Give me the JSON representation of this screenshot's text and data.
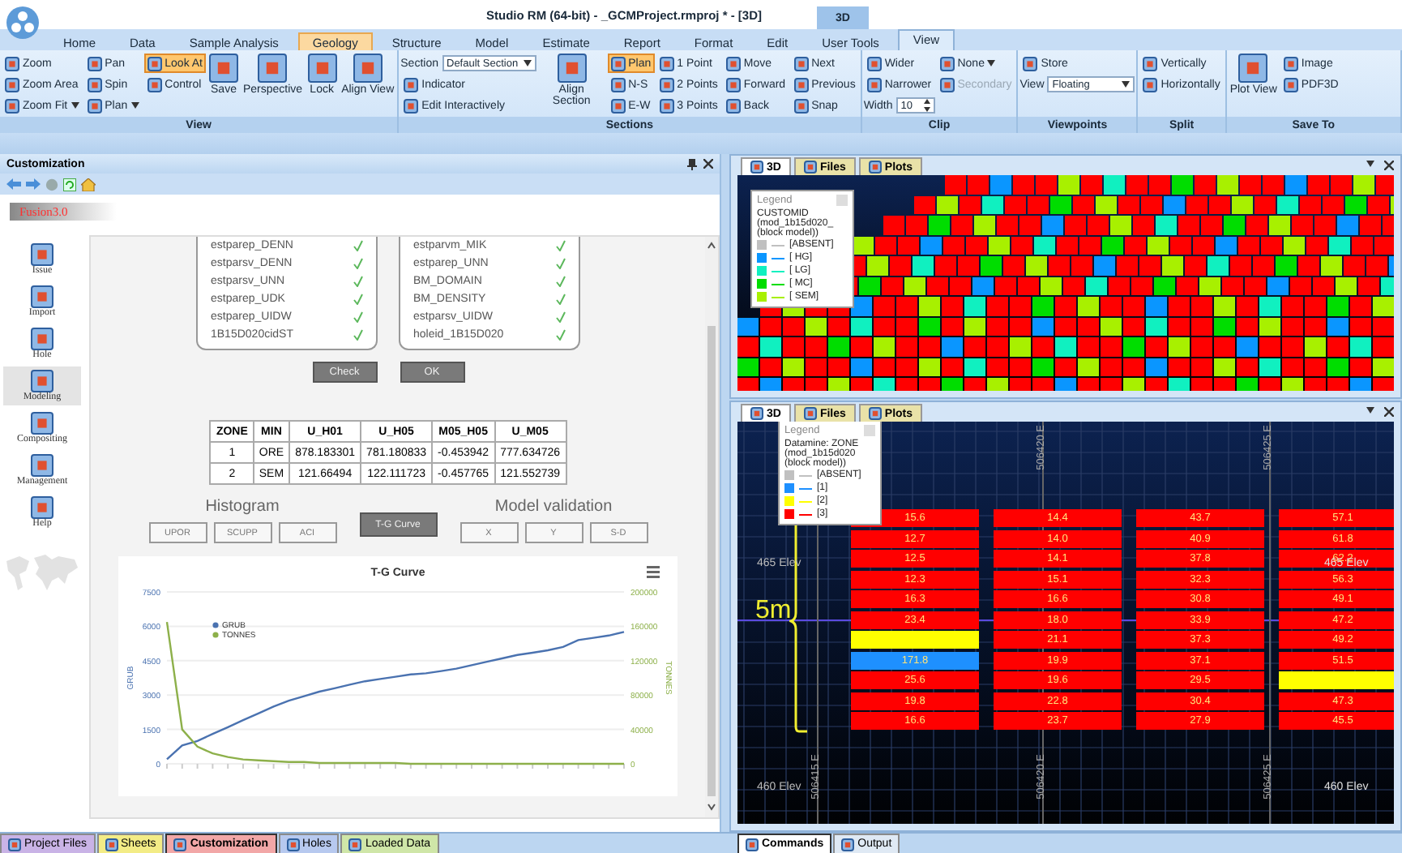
{
  "window": {
    "title": "Studio RM (64-bit) - _GCMProject.rmproj * - [3D]",
    "context_tab": "3D"
  },
  "ribbon_tabs": [
    {
      "label": "Home",
      "selected": false,
      "highlighted": false
    },
    {
      "label": "Data",
      "selected": false,
      "highlighted": false
    },
    {
      "label": "Sample Analysis",
      "selected": false,
      "highlighted": false
    },
    {
      "label": "Geology",
      "selected": false,
      "highlighted": true
    },
    {
      "label": "Structure",
      "selected": false,
      "highlighted": false
    },
    {
      "label": "Model",
      "selected": false,
      "highlighted": false
    },
    {
      "label": "Estimate",
      "selected": false,
      "highlighted": false
    },
    {
      "label": "Report",
      "selected": false,
      "highlighted": false
    },
    {
      "label": "Format",
      "selected": false,
      "highlighted": false
    },
    {
      "label": "Edit",
      "selected": false,
      "highlighted": false
    },
    {
      "label": "User Tools",
      "selected": false,
      "highlighted": false
    },
    {
      "label": "View",
      "selected": true,
      "highlighted": false
    }
  ],
  "ribbon_groups": [
    {
      "label": "View",
      "columns": [
        [
          {
            "label": "Zoom",
            "kind": "small"
          },
          {
            "label": "Zoom Area",
            "kind": "small"
          },
          {
            "label": "Zoom Fit",
            "kind": "menu"
          }
        ],
        [
          {
            "label": "Pan",
            "kind": "small"
          },
          {
            "label": "Spin",
            "kind": "small"
          },
          {
            "label": "Plan",
            "kind": "menu"
          }
        ],
        [
          {
            "label": "Look At",
            "kind": "pressed"
          },
          {
            "label": "Control",
            "kind": "small"
          }
        ],
        [
          {
            "label": "Save",
            "kind": "large"
          }
        ],
        [
          {
            "label": "Perspective",
            "kind": "large"
          }
        ],
        [
          {
            "label": "Lock",
            "kind": "large"
          }
        ],
        [
          {
            "label": "Align View",
            "kind": "large"
          }
        ]
      ]
    },
    {
      "label": "Sections",
      "columns": [
        [
          {
            "label": "Section",
            "kind": "select",
            "value": "Default Section"
          },
          {
            "label": "Indicator",
            "kind": "small"
          },
          {
            "label": "Edit Interactively",
            "kind": "small"
          }
        ],
        [
          {
            "label": "Align Section",
            "kind": "large"
          }
        ],
        [
          {
            "label": "Plan",
            "kind": "pressed"
          },
          {
            "label": "N-S",
            "kind": "small"
          },
          {
            "label": "E-W",
            "kind": "small"
          }
        ],
        [
          {
            "label": "1 Point",
            "kind": "small"
          },
          {
            "label": "2 Points",
            "kind": "small"
          },
          {
            "label": "3 Points",
            "kind": "small"
          }
        ],
        [
          {
            "label": "Move",
            "kind": "small"
          },
          {
            "label": "Forward",
            "kind": "small"
          },
          {
            "label": "Back",
            "kind": "small"
          }
        ],
        [
          {
            "label": "Next",
            "kind": "small"
          },
          {
            "label": "Previous",
            "kind": "small"
          },
          {
            "label": "Snap",
            "kind": "small"
          }
        ]
      ]
    },
    {
      "label": "Clip",
      "columns": [
        [
          {
            "label": "Wider",
            "kind": "small"
          },
          {
            "label": "Narrower",
            "kind": "small"
          },
          {
            "label": "Width",
            "kind": "spin",
            "value": "10"
          }
        ],
        [
          {
            "label": "None",
            "kind": "menu"
          },
          {
            "label": "Secondary",
            "kind": "disabled"
          }
        ]
      ]
    },
    {
      "label": "Viewpoints",
      "columns": [
        [
          {
            "label": "Store",
            "kind": "small"
          },
          {
            "label": "View",
            "kind": "select",
            "value": "Floating"
          }
        ]
      ]
    },
    {
      "label": "Split",
      "columns": [
        [
          {
            "label": "Vertically",
            "kind": "small"
          },
          {
            "label": "Horizontally",
            "kind": "small"
          }
        ]
      ]
    },
    {
      "label": "Save To",
      "columns": [
        [
          {
            "label": "Plot View",
            "kind": "large"
          }
        ],
        [
          {
            "label": "Image",
            "kind": "small"
          },
          {
            "label": "PDF3D",
            "kind": "small"
          }
        ]
      ]
    }
  ],
  "panel": {
    "title": "Customization",
    "brand": "Fusion3.0",
    "nav": [
      {
        "label": "Issue",
        "selected": false
      },
      {
        "label": "Import",
        "selected": false
      },
      {
        "label": "Hole",
        "selected": false
      },
      {
        "label": "Modeling",
        "selected": true
      },
      {
        "label": "Compositing",
        "selected": false
      },
      {
        "label": "Management",
        "selected": false
      },
      {
        "label": "Help",
        "selected": false
      }
    ],
    "lists": [
      [
        {
          "name": "estparep_DENN",
          "checked": true
        },
        {
          "name": "estparsv_DENN",
          "checked": true
        },
        {
          "name": "estparsv_UNN",
          "checked": true
        },
        {
          "name": "estparep_UDK",
          "checked": true
        },
        {
          "name": "estparep_UIDW",
          "checked": true
        },
        {
          "name": "1B15D020cidST",
          "checked": true
        }
      ],
      [
        {
          "name": "estparvm_MIK",
          "checked": true
        },
        {
          "name": "estparep_UNN",
          "checked": true
        },
        {
          "name": "BM_DOMAIN",
          "checked": true
        },
        {
          "name": "BM_DENSITY",
          "checked": true
        },
        {
          "name": "estparsv_UIDW",
          "checked": true
        },
        {
          "name": "holeid_1B15D020",
          "checked": true
        }
      ]
    ],
    "buttons": [
      {
        "label": "Check"
      },
      {
        "label": "OK"
      }
    ],
    "table": {
      "columns": [
        "ZONE",
        "MIN",
        "U_H01",
        "U_H05",
        "M05_H05",
        "U_M05"
      ],
      "rows": [
        [
          "1",
          "ORE",
          "878.183301",
          "781.180833",
          "-0.453942",
          "777.634726"
        ],
        [
          "2",
          "SEM",
          "121.66494",
          "122.111723",
          "-0.457765",
          "121.552739"
        ]
      ]
    },
    "histogram": {
      "title": "Histogram",
      "buttons": [
        {
          "label": "UPOR",
          "selected": false
        },
        {
          "label": "SCUPP",
          "selected": false
        },
        {
          "label": "ACI",
          "selected": false
        }
      ]
    },
    "tg_button": {
      "label": "T-G Curve",
      "selected": true
    },
    "validation": {
      "title": "Model validation",
      "buttons": [
        {
          "label": "X",
          "selected": false
        },
        {
          "label": "Y",
          "selected": false
        },
        {
          "label": "S-D",
          "selected": false
        }
      ]
    },
    "chart_data": {
      "type": "line",
      "title": "T-G Curve",
      "ylabel": "GRUB",
      "y2label": "TONNES",
      "grid": true,
      "legend": true,
      "ylim": [
        0,
        7500
      ],
      "yticks": [
        0,
        1500,
        3000,
        4500,
        6000,
        7500
      ],
      "y2lim": [
        0,
        200000
      ],
      "y2ticks": [
        0,
        40000,
        80000,
        120000,
        160000,
        200000
      ],
      "series": [
        {
          "name": "GRUB",
          "color": "#4a72b0",
          "values": [
            200,
            800,
            1000,
            1300,
            1600,
            1900,
            2200,
            2500,
            2750,
            2950,
            3150,
            3300,
            3450,
            3600,
            3700,
            3800,
            3900,
            3950,
            4050,
            4150,
            4300,
            4450,
            4600,
            4750,
            4850,
            4950,
            5100,
            5400,
            5500,
            5600,
            5750
          ]
        },
        {
          "name": "TONNES",
          "color": "#8db04a",
          "axis": "y2",
          "values": [
            165000,
            40000,
            20000,
            12000,
            8000,
            5000,
            4000,
            3000,
            2000,
            2000,
            1000,
            1000,
            1000,
            1000,
            1000,
            1000,
            0,
            0,
            0,
            0,
            0,
            0,
            0,
            0,
            0,
            0,
            0,
            0,
            0,
            0,
            0
          ]
        }
      ]
    }
  },
  "panel_tabs": [
    {
      "label": "Project Files",
      "color": "#c9b3e6",
      "selected": false
    },
    {
      "label": "Sheets",
      "color": "#f3ec86",
      "selected": false
    },
    {
      "label": "Customization",
      "color": "#f2a7a7",
      "selected": true
    },
    {
      "label": "Holes",
      "color": "#b7c9ef",
      "selected": false
    },
    {
      "label": "Loaded Data",
      "color": "#cfe6a8",
      "selected": false
    }
  ],
  "views": [
    {
      "kind": "overview",
      "tabs": [
        {
          "label": "3D",
          "selected": true
        },
        {
          "label": "Files",
          "selected": false
        },
        {
          "label": "Plots",
          "selected": false
        }
      ],
      "legend": {
        "title": "Legend",
        "heading": [
          "CUSTOMID",
          "(mod_1b15d020_",
          "(block model))"
        ],
        "items": [
          {
            "label": "[ABSENT]",
            "color": "#c0c0c0"
          },
          {
            "label": "[ HG]",
            "color": "#0a96ff"
          },
          {
            "label": "[ LG]",
            "color": "#10f0c0"
          },
          {
            "label": "[ MC]",
            "color": "#00dd00"
          },
          {
            "label": "[ SEM]",
            "color": "#a8f000"
          }
        ]
      }
    },
    {
      "kind": "section",
      "tabs": [
        {
          "label": "3D",
          "selected": true
        },
        {
          "label": "Files",
          "selected": false
        },
        {
          "label": "Plots",
          "selected": false
        }
      ],
      "legend": {
        "title": "Legend",
        "heading": [
          "Datamine: ZONE",
          "(mod_1b15d020",
          "(block model))"
        ],
        "items": [
          {
            "label": "[ABSENT]",
            "color": "#c0c0c0"
          },
          {
            "label": "[1]",
            "color": "#1e90ff"
          },
          {
            "label": "[2]",
            "color": "#ffff00"
          },
          {
            "label": "[3]",
            "color": "#ff0000"
          }
        ]
      },
      "easting_lines": [
        {
          "bottom": "506415 E"
        },
        {
          "top": "506420 E",
          "bottom": "506420 E"
        },
        {
          "top": "506425 E",
          "bottom": "506425 E"
        }
      ],
      "elevations": [
        {
          "left": "465 Elev",
          "right": "465 Elev"
        },
        {
          "left": "460 Elev",
          "right": "460 Elev"
        }
      ],
      "annotation": "5m",
      "block_columns": [
        [
          {
            "value": "15.6",
            "color": "#ff0000"
          },
          {
            "value": "12.7",
            "color": "#ff0000"
          },
          {
            "value": "12.5",
            "color": "#ff0000"
          },
          {
            "value": "12.3",
            "color": "#ff0000"
          },
          {
            "value": "16.3",
            "color": "#ff0000"
          },
          {
            "value": "23.4",
            "color": "#ff0000"
          },
          {
            "color": "#ffff00"
          },
          {
            "value": "171.8",
            "color": "#1e90ff"
          },
          {
            "value": "25.6",
            "color": "#ff0000"
          },
          {
            "value": "19.8",
            "color": "#ff0000"
          },
          {
            "value": "16.6",
            "color": "#ff0000"
          }
        ],
        [
          {
            "value": "14.4",
            "color": "#ff0000"
          },
          {
            "value": "14.0",
            "color": "#ff0000"
          },
          {
            "value": "14.1",
            "color": "#ff0000"
          },
          {
            "value": "15.1",
            "color": "#ff0000"
          },
          {
            "value": "16.6",
            "color": "#ff0000"
          },
          {
            "value": "18.0",
            "color": "#ff0000"
          },
          {
            "value": "21.1",
            "color": "#ff0000"
          },
          {
            "value": "19.9",
            "color": "#ff0000"
          },
          {
            "value": "19.6",
            "color": "#ff0000"
          },
          {
            "value": "22.8",
            "color": "#ff0000"
          },
          {
            "value": "23.7",
            "color": "#ff0000"
          }
        ],
        [
          {
            "value": "43.7",
            "color": "#ff0000"
          },
          {
            "value": "40.9",
            "color": "#ff0000"
          },
          {
            "value": "37.8",
            "color": "#ff0000"
          },
          {
            "value": "32.3",
            "color": "#ff0000"
          },
          {
            "value": "30.8",
            "color": "#ff0000"
          },
          {
            "value": "33.9",
            "color": "#ff0000"
          },
          {
            "value": "37.3",
            "color": "#ff0000"
          },
          {
            "value": "37.1",
            "color": "#ff0000"
          },
          {
            "value": "29.5",
            "color": "#ff0000"
          },
          {
            "value": "30.4",
            "color": "#ff0000"
          },
          {
            "value": "27.9",
            "color": "#ff0000"
          }
        ],
        [
          {
            "value": "57.1",
            "color": "#ff0000"
          },
          {
            "value": "61.8",
            "color": "#ff0000"
          },
          {
            "value": "62.2",
            "color": "#ff0000"
          },
          {
            "value": "56.3",
            "color": "#ff0000"
          },
          {
            "value": "49.1",
            "color": "#ff0000"
          },
          {
            "value": "47.2",
            "color": "#ff0000"
          },
          {
            "value": "49.2",
            "color": "#ff0000"
          },
          {
            "value": "51.5",
            "color": "#ff0000"
          },
          {
            "color": "#ffff00"
          },
          {
            "value": "47.3",
            "color": "#ff0000"
          },
          {
            "value": "45.5",
            "color": "#ff0000"
          }
        ]
      ]
    }
  ],
  "view_tabs": [
    {
      "label": "Commands",
      "selected": true
    },
    {
      "label": "Output",
      "selected": false
    }
  ]
}
